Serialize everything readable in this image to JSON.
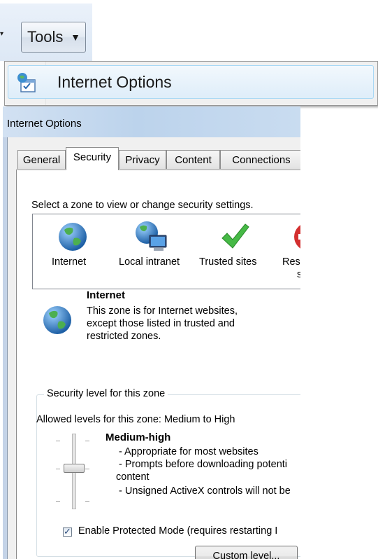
{
  "toolbar": {
    "prev_chevron": "▾",
    "tools_label": "Tools",
    "tools_arrow": "▼"
  },
  "menu": {
    "internet_options_label": "Internet Options",
    "icon": "internet-options-icon"
  },
  "dialog": {
    "title": "Internet Options",
    "tabs": [
      {
        "label": "General",
        "active": false
      },
      {
        "label": "Security",
        "active": true
      },
      {
        "label": "Privacy",
        "active": false
      },
      {
        "label": "Content",
        "active": false
      },
      {
        "label": "Connections",
        "active": false
      }
    ],
    "zone_instruction": "Select a zone to view or change security settings.",
    "zones": [
      {
        "label": "Internet",
        "icon": "globe-icon"
      },
      {
        "label": "Local intranet",
        "icon": "intranet-icon"
      },
      {
        "label": "Trusted sites",
        "icon": "checkmark-icon"
      },
      {
        "label": "Res",
        "label_line2": "s",
        "icon": "restricted-icon"
      }
    ],
    "selected_zone": {
      "name": "Internet",
      "description_lines": [
        "This zone is for Internet websites,",
        "except those listed in trusted and",
        "restricted zones."
      ]
    },
    "security_level": {
      "group_label": "Security level for this zone",
      "allowed_levels": "Allowed levels for this zone: Medium to High",
      "level_name": "Medium-high",
      "level_lines": [
        "- Appropriate for most websites",
        "- Prompts before downloading potenti",
        "content",
        "- Unsigned ActiveX controls will not be"
      ],
      "slider_level_fraction": 0.5
    },
    "protected_mode": {
      "label": "Enable Protected Mode (requires restarting I",
      "checked": true
    },
    "custom_level_label": "Custom level..."
  },
  "colors": {
    "accent_blue": "#3c7fb1",
    "trusted_green": "#3cb371",
    "restricted_red": "#d32f2f"
  }
}
